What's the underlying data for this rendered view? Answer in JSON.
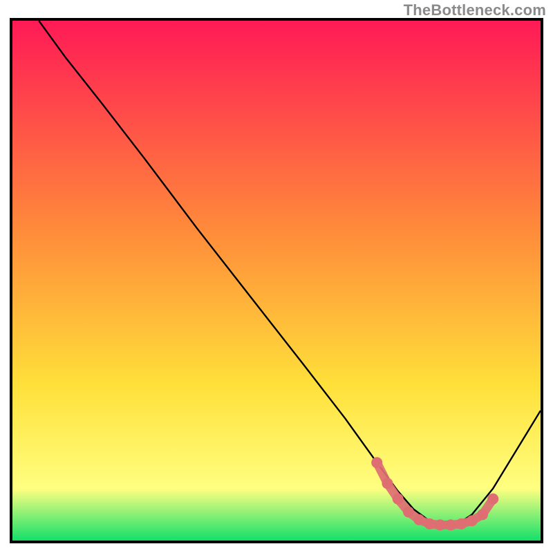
{
  "watermark": {
    "text": "TheBottleneck.com"
  },
  "chart_data": {
    "type": "line",
    "title": "",
    "xlabel": "",
    "ylabel": "",
    "xlim": [
      0,
      100
    ],
    "ylim": [
      0,
      100
    ],
    "grid": false,
    "legend": false,
    "background_gradient": {
      "colors": [
        "#ff1a56",
        "#ff8a3a",
        "#ffe03a",
        "#ffff80",
        "#13e06a"
      ],
      "positions": [
        0,
        40,
        70,
        90,
        100
      ]
    },
    "series": [
      {
        "name": "bottleneck-curve",
        "color": "#000000",
        "x": [
          5,
          10,
          17,
          25,
          35,
          45,
          55,
          63,
          69,
          73,
          76,
          80,
          84,
          87,
          91,
          100
        ],
        "y": [
          100,
          93,
          84,
          73.5,
          60,
          47,
          34,
          23.5,
          15,
          9.5,
          6,
          3,
          3,
          5,
          10,
          25
        ]
      },
      {
        "name": "optimal-band",
        "type": "scatter",
        "color": "#de6e72",
        "marker_radius": 8,
        "x": [
          69,
          71,
          73,
          75,
          77,
          79,
          81,
          83,
          85,
          87,
          89,
          91
        ],
        "y": [
          15,
          11,
          8,
          5.5,
          4,
          3.2,
          3,
          3,
          3.2,
          3.8,
          5,
          8
        ]
      }
    ]
  }
}
